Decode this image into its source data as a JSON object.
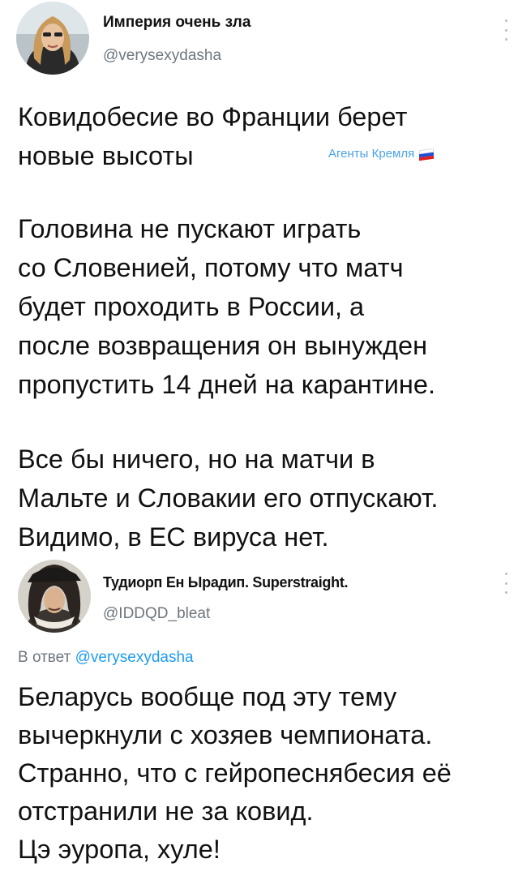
{
  "tweet1": {
    "author": {
      "display_name": "Империя очень зла",
      "handle": "@verysexydasha"
    },
    "paragraphs": [
      "Ковидобесие во Франции берет\nновые высоты",
      "Головина не пускают играть\nсо Словенией, потому что матч\nбудет проходить в России, а\nпосле возвращения он вынужден\nпропустить 14 дней на карантине.",
      "Все бы ничего, но на матчи в\nМальте и Словакии его отпускают.\nВидимо, в ЕС вируса нет."
    ],
    "watermark": {
      "text": "Агенты Кремля",
      "icon": "russian-flag-icon",
      "flag_colors": [
        "#ffffff",
        "#1d4fd8",
        "#e02020"
      ]
    },
    "more_icon": "more-vertical-icon"
  },
  "tweet2": {
    "author": {
      "display_name": "Тудиорп Ен Ырадип. Superstraight.",
      "handle": "@IDDQD_bleat"
    },
    "reply_to": {
      "prefix": "В ответ",
      "mention": "@verysexydasha"
    },
    "paragraphs": [
      "Беларусь вообще под эту тему\nвычеркнули с хозяев  чемпионата.\nСтранно, что с гейропеснябесия её\nотстранили не за ковид.\nЦэ эуропа, хуле!"
    ],
    "more_icon": "more-vertical-icon"
  },
  "colors": {
    "text": "#111111",
    "secondary": "#6e767d",
    "link": "#1d9bf0",
    "watermark": "#4aa3e8"
  }
}
